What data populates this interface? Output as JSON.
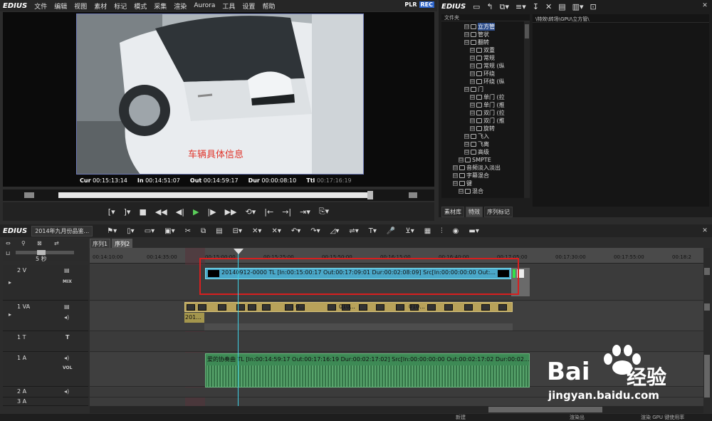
{
  "app": {
    "name": "EDIUS"
  },
  "menu": [
    "文件",
    "编辑",
    "视图",
    "素材",
    "标记",
    "模式",
    "采集",
    "渲染",
    "Aurora",
    "工具",
    "设置",
    "帮助"
  ],
  "player": {
    "mode_plr": "PLR",
    "mode_rec": "REC",
    "overlay_text": "车辆具体信息",
    "cur_label": "Cur",
    "cur": "00:15:13:14",
    "in_label": "In",
    "in": "00:14:51:07",
    "out_label": "Out",
    "out": "00:14:59:17",
    "dur_label": "Dur",
    "dur": "00:00:08:10",
    "ttl_label": "Ttl",
    "ttl": "00:17:16:19"
  },
  "bin": {
    "title": "EDIUS",
    "tree_header": "文件夹",
    "path": "\\特效\\转场\\GPU\\立方管\\",
    "tree": [
      {
        "label": "立方管",
        "indent": 3,
        "selected": true
      },
      {
        "label": "管状",
        "indent": 3
      },
      {
        "label": "翻转",
        "indent": 3
      },
      {
        "label": "双重",
        "indent": 4
      },
      {
        "label": "常规",
        "indent": 4
      },
      {
        "label": "常规 (纵",
        "indent": 4
      },
      {
        "label": "环绕",
        "indent": 4
      },
      {
        "label": "环绕 (纵",
        "indent": 4
      },
      {
        "label": "门",
        "indent": 3
      },
      {
        "label": "单门 (拉",
        "indent": 4
      },
      {
        "label": "单门 (推",
        "indent": 4
      },
      {
        "label": "双门 (拉",
        "indent": 4
      },
      {
        "label": "双门 (推",
        "indent": 4
      },
      {
        "label": "旋转",
        "indent": 4
      },
      {
        "label": "飞入",
        "indent": 3
      },
      {
        "label": "飞离",
        "indent": 3
      },
      {
        "label": "高级",
        "indent": 3
      },
      {
        "label": "SMPTE",
        "indent": 2
      },
      {
        "label": "音频淡入淡出",
        "indent": 1
      },
      {
        "label": "字幕混合",
        "indent": 1
      },
      {
        "label": "键",
        "indent": 1
      },
      {
        "label": "混合",
        "indent": 2
      }
    ],
    "tabs": [
      "素材库",
      "特效",
      "序列标记"
    ]
  },
  "timeline": {
    "title": "EDIUS",
    "project": "2014年九月份品鉴...",
    "seq_tabs": [
      "序列1",
      "序列2"
    ],
    "zoom": "5 秒",
    "ruler": [
      "00:14:10:00",
      "00:14:35:00",
      "00:15:00:00",
      "00:15:25:00",
      "00:15:50:00",
      "00:16:15:00",
      "00:16:40:00",
      "00:17:05:00",
      "00:17:30:00",
      "00:17:55:00",
      "00:18:2"
    ],
    "tracks": {
      "v2": "2 V",
      "v2_mix": "MIX",
      "va1": "1 VA",
      "t1": "1 T",
      "a1": "1 A",
      "a1_vol": "VOL",
      "a2": "2 A",
      "a3": "3 A"
    },
    "video_clip": "20140912-0000  TL [In:00:15:00:17 Out:00:17:09:01 Dur:00:02:08:09]  Src[In:00:00:00:00 Out:...",
    "va_labels": [
      "0...",
      "010...",
      "010...",
      "201..."
    ],
    "audio_clip_title": "爱的协奏曲",
    "audio_clip": "TL [In:00:14:59:17 Out:00:17:16:19 Dur:00:02:17:02]  Src[In:00:00:00:00 Out:00:02:17:02 Dur:00:02..."
  },
  "watermark": {
    "brand": "Bai",
    "brand2": "经验",
    "url": "jingyan.baidu.com"
  },
  "status": {
    "a": "新建",
    "b": "渲染出",
    "c": "渲染 GPU 键使用率"
  }
}
